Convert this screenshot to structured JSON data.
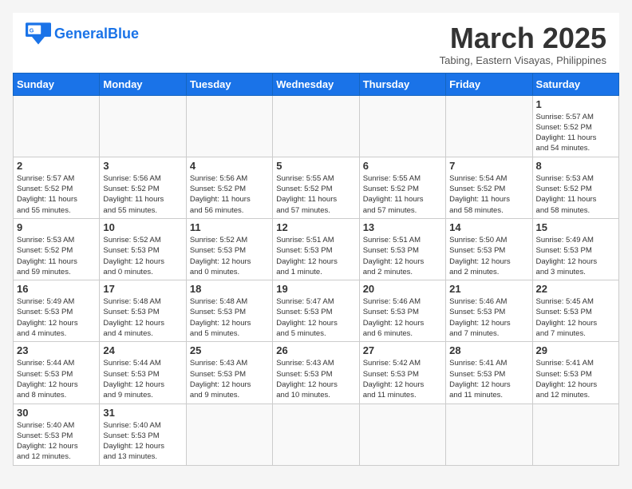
{
  "logo": {
    "text_general": "General",
    "text_blue": "Blue"
  },
  "header": {
    "month": "March 2025",
    "location": "Tabing, Eastern Visayas, Philippines"
  },
  "weekdays": [
    "Sunday",
    "Monday",
    "Tuesday",
    "Wednesday",
    "Thursday",
    "Friday",
    "Saturday"
  ],
  "weeks": [
    [
      {
        "day": "",
        "info": ""
      },
      {
        "day": "",
        "info": ""
      },
      {
        "day": "",
        "info": ""
      },
      {
        "day": "",
        "info": ""
      },
      {
        "day": "",
        "info": ""
      },
      {
        "day": "",
        "info": ""
      },
      {
        "day": "1",
        "info": "Sunrise: 5:57 AM\nSunset: 5:52 PM\nDaylight: 11 hours\nand 54 minutes."
      }
    ],
    [
      {
        "day": "2",
        "info": "Sunrise: 5:57 AM\nSunset: 5:52 PM\nDaylight: 11 hours\nand 55 minutes."
      },
      {
        "day": "3",
        "info": "Sunrise: 5:56 AM\nSunset: 5:52 PM\nDaylight: 11 hours\nand 55 minutes."
      },
      {
        "day": "4",
        "info": "Sunrise: 5:56 AM\nSunset: 5:52 PM\nDaylight: 11 hours\nand 56 minutes."
      },
      {
        "day": "5",
        "info": "Sunrise: 5:55 AM\nSunset: 5:52 PM\nDaylight: 11 hours\nand 57 minutes."
      },
      {
        "day": "6",
        "info": "Sunrise: 5:55 AM\nSunset: 5:52 PM\nDaylight: 11 hours\nand 57 minutes."
      },
      {
        "day": "7",
        "info": "Sunrise: 5:54 AM\nSunset: 5:52 PM\nDaylight: 11 hours\nand 58 minutes."
      },
      {
        "day": "8",
        "info": "Sunrise: 5:53 AM\nSunset: 5:52 PM\nDaylight: 11 hours\nand 58 minutes."
      }
    ],
    [
      {
        "day": "9",
        "info": "Sunrise: 5:53 AM\nSunset: 5:52 PM\nDaylight: 11 hours\nand 59 minutes."
      },
      {
        "day": "10",
        "info": "Sunrise: 5:52 AM\nSunset: 5:53 PM\nDaylight: 12 hours\nand 0 minutes."
      },
      {
        "day": "11",
        "info": "Sunrise: 5:52 AM\nSunset: 5:53 PM\nDaylight: 12 hours\nand 0 minutes."
      },
      {
        "day": "12",
        "info": "Sunrise: 5:51 AM\nSunset: 5:53 PM\nDaylight: 12 hours\nand 1 minute."
      },
      {
        "day": "13",
        "info": "Sunrise: 5:51 AM\nSunset: 5:53 PM\nDaylight: 12 hours\nand 2 minutes."
      },
      {
        "day": "14",
        "info": "Sunrise: 5:50 AM\nSunset: 5:53 PM\nDaylight: 12 hours\nand 2 minutes."
      },
      {
        "day": "15",
        "info": "Sunrise: 5:49 AM\nSunset: 5:53 PM\nDaylight: 12 hours\nand 3 minutes."
      }
    ],
    [
      {
        "day": "16",
        "info": "Sunrise: 5:49 AM\nSunset: 5:53 PM\nDaylight: 12 hours\nand 4 minutes."
      },
      {
        "day": "17",
        "info": "Sunrise: 5:48 AM\nSunset: 5:53 PM\nDaylight: 12 hours\nand 4 minutes."
      },
      {
        "day": "18",
        "info": "Sunrise: 5:48 AM\nSunset: 5:53 PM\nDaylight: 12 hours\nand 5 minutes."
      },
      {
        "day": "19",
        "info": "Sunrise: 5:47 AM\nSunset: 5:53 PM\nDaylight: 12 hours\nand 5 minutes."
      },
      {
        "day": "20",
        "info": "Sunrise: 5:46 AM\nSunset: 5:53 PM\nDaylight: 12 hours\nand 6 minutes."
      },
      {
        "day": "21",
        "info": "Sunrise: 5:46 AM\nSunset: 5:53 PM\nDaylight: 12 hours\nand 7 minutes."
      },
      {
        "day": "22",
        "info": "Sunrise: 5:45 AM\nSunset: 5:53 PM\nDaylight: 12 hours\nand 7 minutes."
      }
    ],
    [
      {
        "day": "23",
        "info": "Sunrise: 5:44 AM\nSunset: 5:53 PM\nDaylight: 12 hours\nand 8 minutes."
      },
      {
        "day": "24",
        "info": "Sunrise: 5:44 AM\nSunset: 5:53 PM\nDaylight: 12 hours\nand 9 minutes."
      },
      {
        "day": "25",
        "info": "Sunrise: 5:43 AM\nSunset: 5:53 PM\nDaylight: 12 hours\nand 9 minutes."
      },
      {
        "day": "26",
        "info": "Sunrise: 5:43 AM\nSunset: 5:53 PM\nDaylight: 12 hours\nand 10 minutes."
      },
      {
        "day": "27",
        "info": "Sunrise: 5:42 AM\nSunset: 5:53 PM\nDaylight: 12 hours\nand 11 minutes."
      },
      {
        "day": "28",
        "info": "Sunrise: 5:41 AM\nSunset: 5:53 PM\nDaylight: 12 hours\nand 11 minutes."
      },
      {
        "day": "29",
        "info": "Sunrise: 5:41 AM\nSunset: 5:53 PM\nDaylight: 12 hours\nand 12 minutes."
      }
    ],
    [
      {
        "day": "30",
        "info": "Sunrise: 5:40 AM\nSunset: 5:53 PM\nDaylight: 12 hours\nand 12 minutes."
      },
      {
        "day": "31",
        "info": "Sunrise: 5:40 AM\nSunset: 5:53 PM\nDaylight: 12 hours\nand 13 minutes."
      },
      {
        "day": "",
        "info": ""
      },
      {
        "day": "",
        "info": ""
      },
      {
        "day": "",
        "info": ""
      },
      {
        "day": "",
        "info": ""
      },
      {
        "day": "",
        "info": ""
      }
    ]
  ]
}
